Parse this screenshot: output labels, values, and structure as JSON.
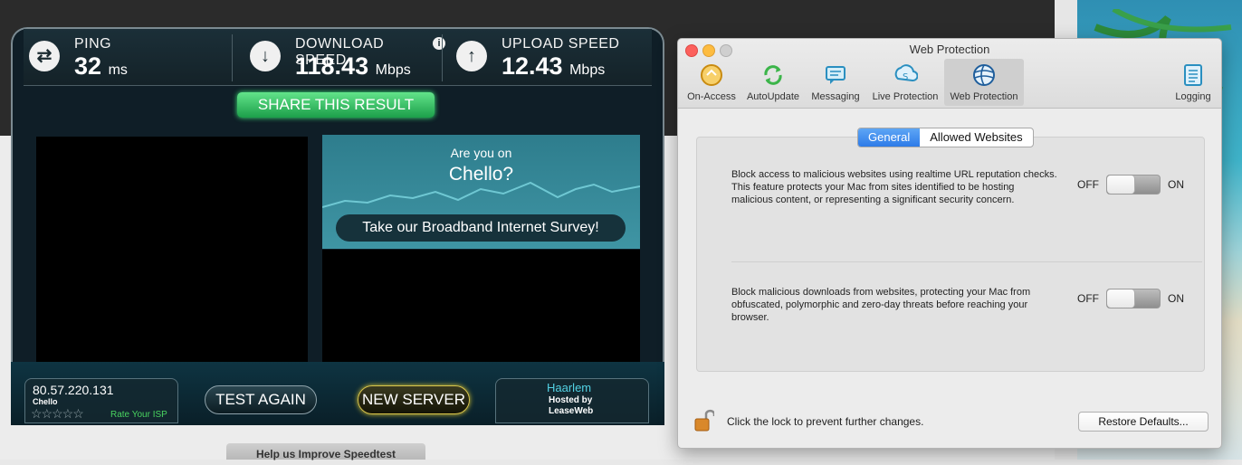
{
  "speedtest": {
    "ping": {
      "label": "PING",
      "value": "32",
      "unit": "ms"
    },
    "download": {
      "label": "DOWNLOAD SPEED",
      "value": "118.43",
      "unit": "Mbps"
    },
    "upload": {
      "label": "UPLOAD SPEED",
      "value": "12.43",
      "unit": "Mbps"
    },
    "share_label": "SHARE THIS RESULT",
    "ad": {
      "subtitle": "Are you on",
      "title": "Chello?",
      "button": "Take our Broadband Internet Survey!"
    },
    "ip": "80.57.220.131",
    "isp": "Chello",
    "rate_label": "Rate Your ISP",
    "stars": "☆☆☆☆☆",
    "test_again": "TEST AGAIN",
    "new_server": "NEW SERVER",
    "server_city": "Haarlem",
    "hosted_by": "Hosted by",
    "host": "LeaseWeb",
    "help_label": "Help us Improve Speedtest"
  },
  "window": {
    "title": "Web Protection",
    "toolbar": [
      {
        "label": "On-Access",
        "icon": "on-access-icon"
      },
      {
        "label": "AutoUpdate",
        "icon": "autoupdate-icon"
      },
      {
        "label": "Messaging",
        "icon": "messaging-icon"
      },
      {
        "label": "Live Protection",
        "icon": "live-protection-icon"
      },
      {
        "label": "Web Protection",
        "icon": "web-protection-icon"
      },
      {
        "label": "Logging",
        "icon": "logging-icon"
      }
    ],
    "tabs": {
      "general": "General",
      "allowed": "Allowed Websites"
    },
    "settings": [
      {
        "description": "Block access to malicious websites using realtime URL reputation checks. This feature protects your Mac from sites identified to be hosting malicious content, or representing a significant security concern.",
        "off": "OFF",
        "on": "ON"
      },
      {
        "description": "Block malicious downloads from websites, protecting your Mac from obfuscated, polymorphic and zero-day threats before reaching your browser.",
        "off": "OFF",
        "on": "ON"
      }
    ],
    "lock_text": "Click the lock to prevent further changes.",
    "restore_label": "Restore Defaults..."
  }
}
